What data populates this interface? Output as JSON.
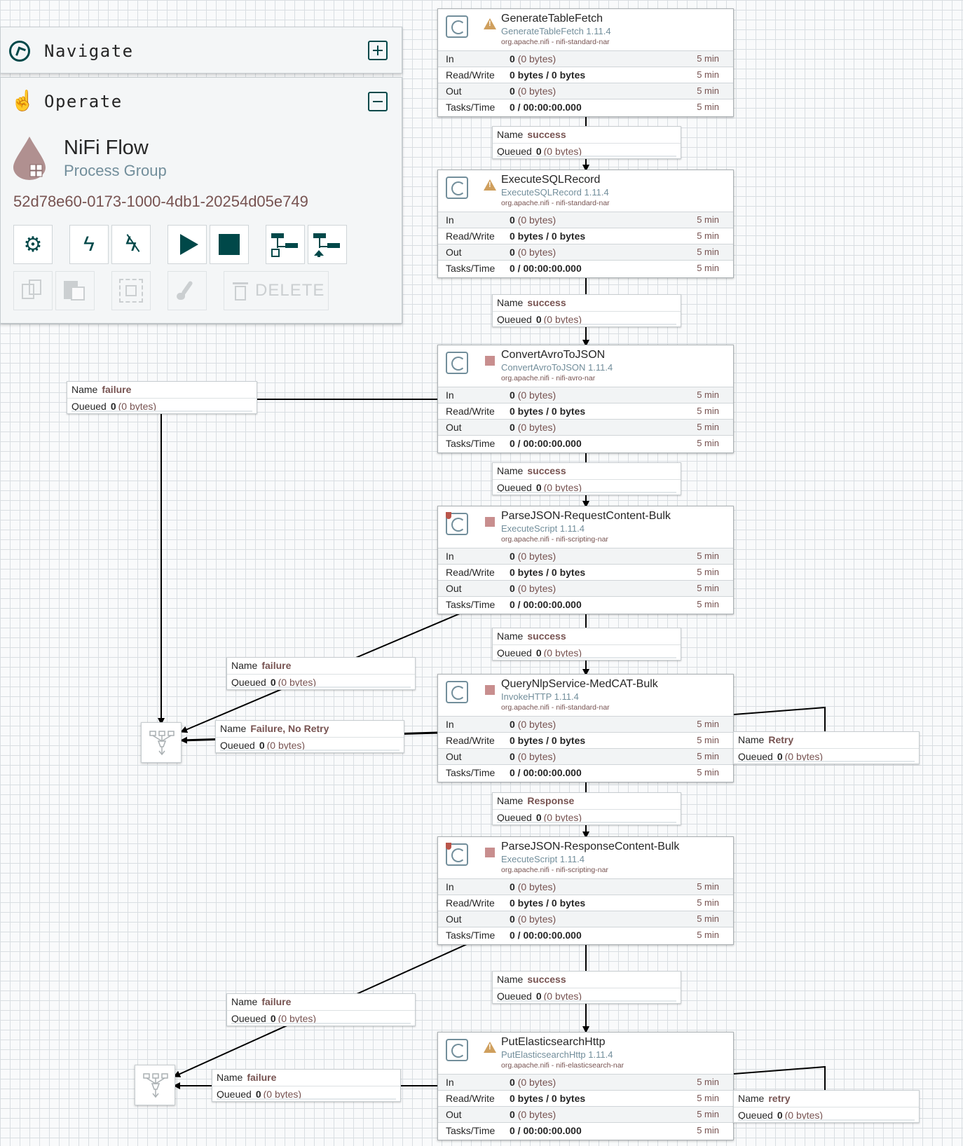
{
  "navigate": {
    "title": "Navigate"
  },
  "operate": {
    "title": "Operate",
    "group_name": "NiFi Flow",
    "group_type": "Process Group",
    "group_id": "52d78e60-0173-1000-4db1-20254d05e749",
    "delete_label": "DELETE"
  },
  "row_labels": {
    "in": "In",
    "rw": "Read/Write",
    "out": "Out",
    "tasks": "Tasks/Time"
  },
  "conn_labels": {
    "name": "Name",
    "queued": "Queued"
  },
  "processors": [
    {
      "name": "GenerateTableFetch",
      "type": "GenerateTableFetch 1.11.4",
      "bundle": "org.apache.nifi - nifi-standard-nar",
      "state": "warning",
      "in": "0",
      "in_size": "(0 bytes)",
      "rw": "0 bytes / 0 bytes",
      "out": "0",
      "out_size": "(0 bytes)",
      "tasks": "0 / 00:00:00.000",
      "window": "5 min"
    },
    {
      "name": "ExecuteSQLRecord",
      "type": "ExecuteSQLRecord 1.11.4",
      "bundle": "org.apache.nifi - nifi-standard-nar",
      "state": "warning",
      "in": "0",
      "in_size": "(0 bytes)",
      "rw": "0 bytes / 0 bytes",
      "out": "0",
      "out_size": "(0 bytes)",
      "tasks": "0 / 00:00:00.000",
      "window": "5 min"
    },
    {
      "name": "ConvertAvroToJSON",
      "type": "ConvertAvroToJSON 1.11.4",
      "bundle": "org.apache.nifi - nifi-avro-nar",
      "state": "stopped",
      "in": "0",
      "in_size": "(0 bytes)",
      "rw": "0 bytes / 0 bytes",
      "out": "0",
      "out_size": "(0 bytes)",
      "tasks": "0 / 00:00:00.000",
      "window": "5 min"
    },
    {
      "name": "ParseJSON-RequestContent-Bulk",
      "type": "ExecuteScript 1.11.4",
      "bundle": "org.apache.nifi - nifi-scripting-nar",
      "state": "stopped",
      "restricted": true,
      "in": "0",
      "in_size": "(0 bytes)",
      "rw": "0 bytes / 0 bytes",
      "out": "0",
      "out_size": "(0 bytes)",
      "tasks": "0 / 00:00:00.000",
      "window": "5 min"
    },
    {
      "name": "QueryNlpService-MedCAT-Bulk",
      "type": "InvokeHTTP 1.11.4",
      "bundle": "org.apache.nifi - nifi-standard-nar",
      "state": "stopped",
      "in": "0",
      "in_size": "(0 bytes)",
      "rw": "0 bytes / 0 bytes",
      "out": "0",
      "out_size": "(0 bytes)",
      "tasks": "0 / 00:00:00.000",
      "window": "5 min"
    },
    {
      "name": "ParseJSON-ResponseContent-Bulk",
      "type": "ExecuteScript 1.11.4",
      "bundle": "org.apache.nifi - nifi-scripting-nar",
      "state": "stopped",
      "restricted": true,
      "in": "0",
      "in_size": "(0 bytes)",
      "rw": "0 bytes / 0 bytes",
      "out": "0",
      "out_size": "(0 bytes)",
      "tasks": "0 / 00:00:00.000",
      "window": "5 min"
    },
    {
      "name": "PutElasticsearchHttp",
      "type": "PutElasticsearchHttp 1.11.4",
      "bundle": "org.apache.nifi - nifi-elasticsearch-nar",
      "state": "warning",
      "in": "0",
      "in_size": "(0 bytes)",
      "rw": "0 bytes / 0 bytes",
      "out": "0",
      "out_size": "(0 bytes)",
      "tasks": "0 / 00:00:00.000",
      "window": "5 min"
    }
  ],
  "connections": [
    {
      "name": "success",
      "queued": "0",
      "size": "(0 bytes)"
    },
    {
      "name": "success",
      "queued": "0",
      "size": "(0 bytes)"
    },
    {
      "name": "failure",
      "queued": "0",
      "size": "(0 bytes)"
    },
    {
      "name": "success",
      "queued": "0",
      "size": "(0 bytes)"
    },
    {
      "name": "success",
      "queued": "0",
      "size": "(0 bytes)"
    },
    {
      "name": "failure",
      "queued": "0",
      "size": "(0 bytes)"
    },
    {
      "name": "Failure, No Retry",
      "queued": "0",
      "size": "(0 bytes)"
    },
    {
      "name": "Retry",
      "queued": "0",
      "size": "(0 bytes)"
    },
    {
      "name": "Response",
      "queued": "0",
      "size": "(0 bytes)"
    },
    {
      "name": "success",
      "queued": "0",
      "size": "(0 bytes)"
    },
    {
      "name": "failure",
      "queued": "0",
      "size": "(0 bytes)"
    },
    {
      "name": "failure",
      "queued": "0",
      "size": "(0 bytes)"
    },
    {
      "name": "retry",
      "queued": "0",
      "size": "(0 bytes)"
    }
  ],
  "colors": {
    "accent": "#004849",
    "warning": "#cf9f5d",
    "stopped": "#c88e8e",
    "label": "#775351",
    "type": "#728e9b"
  }
}
